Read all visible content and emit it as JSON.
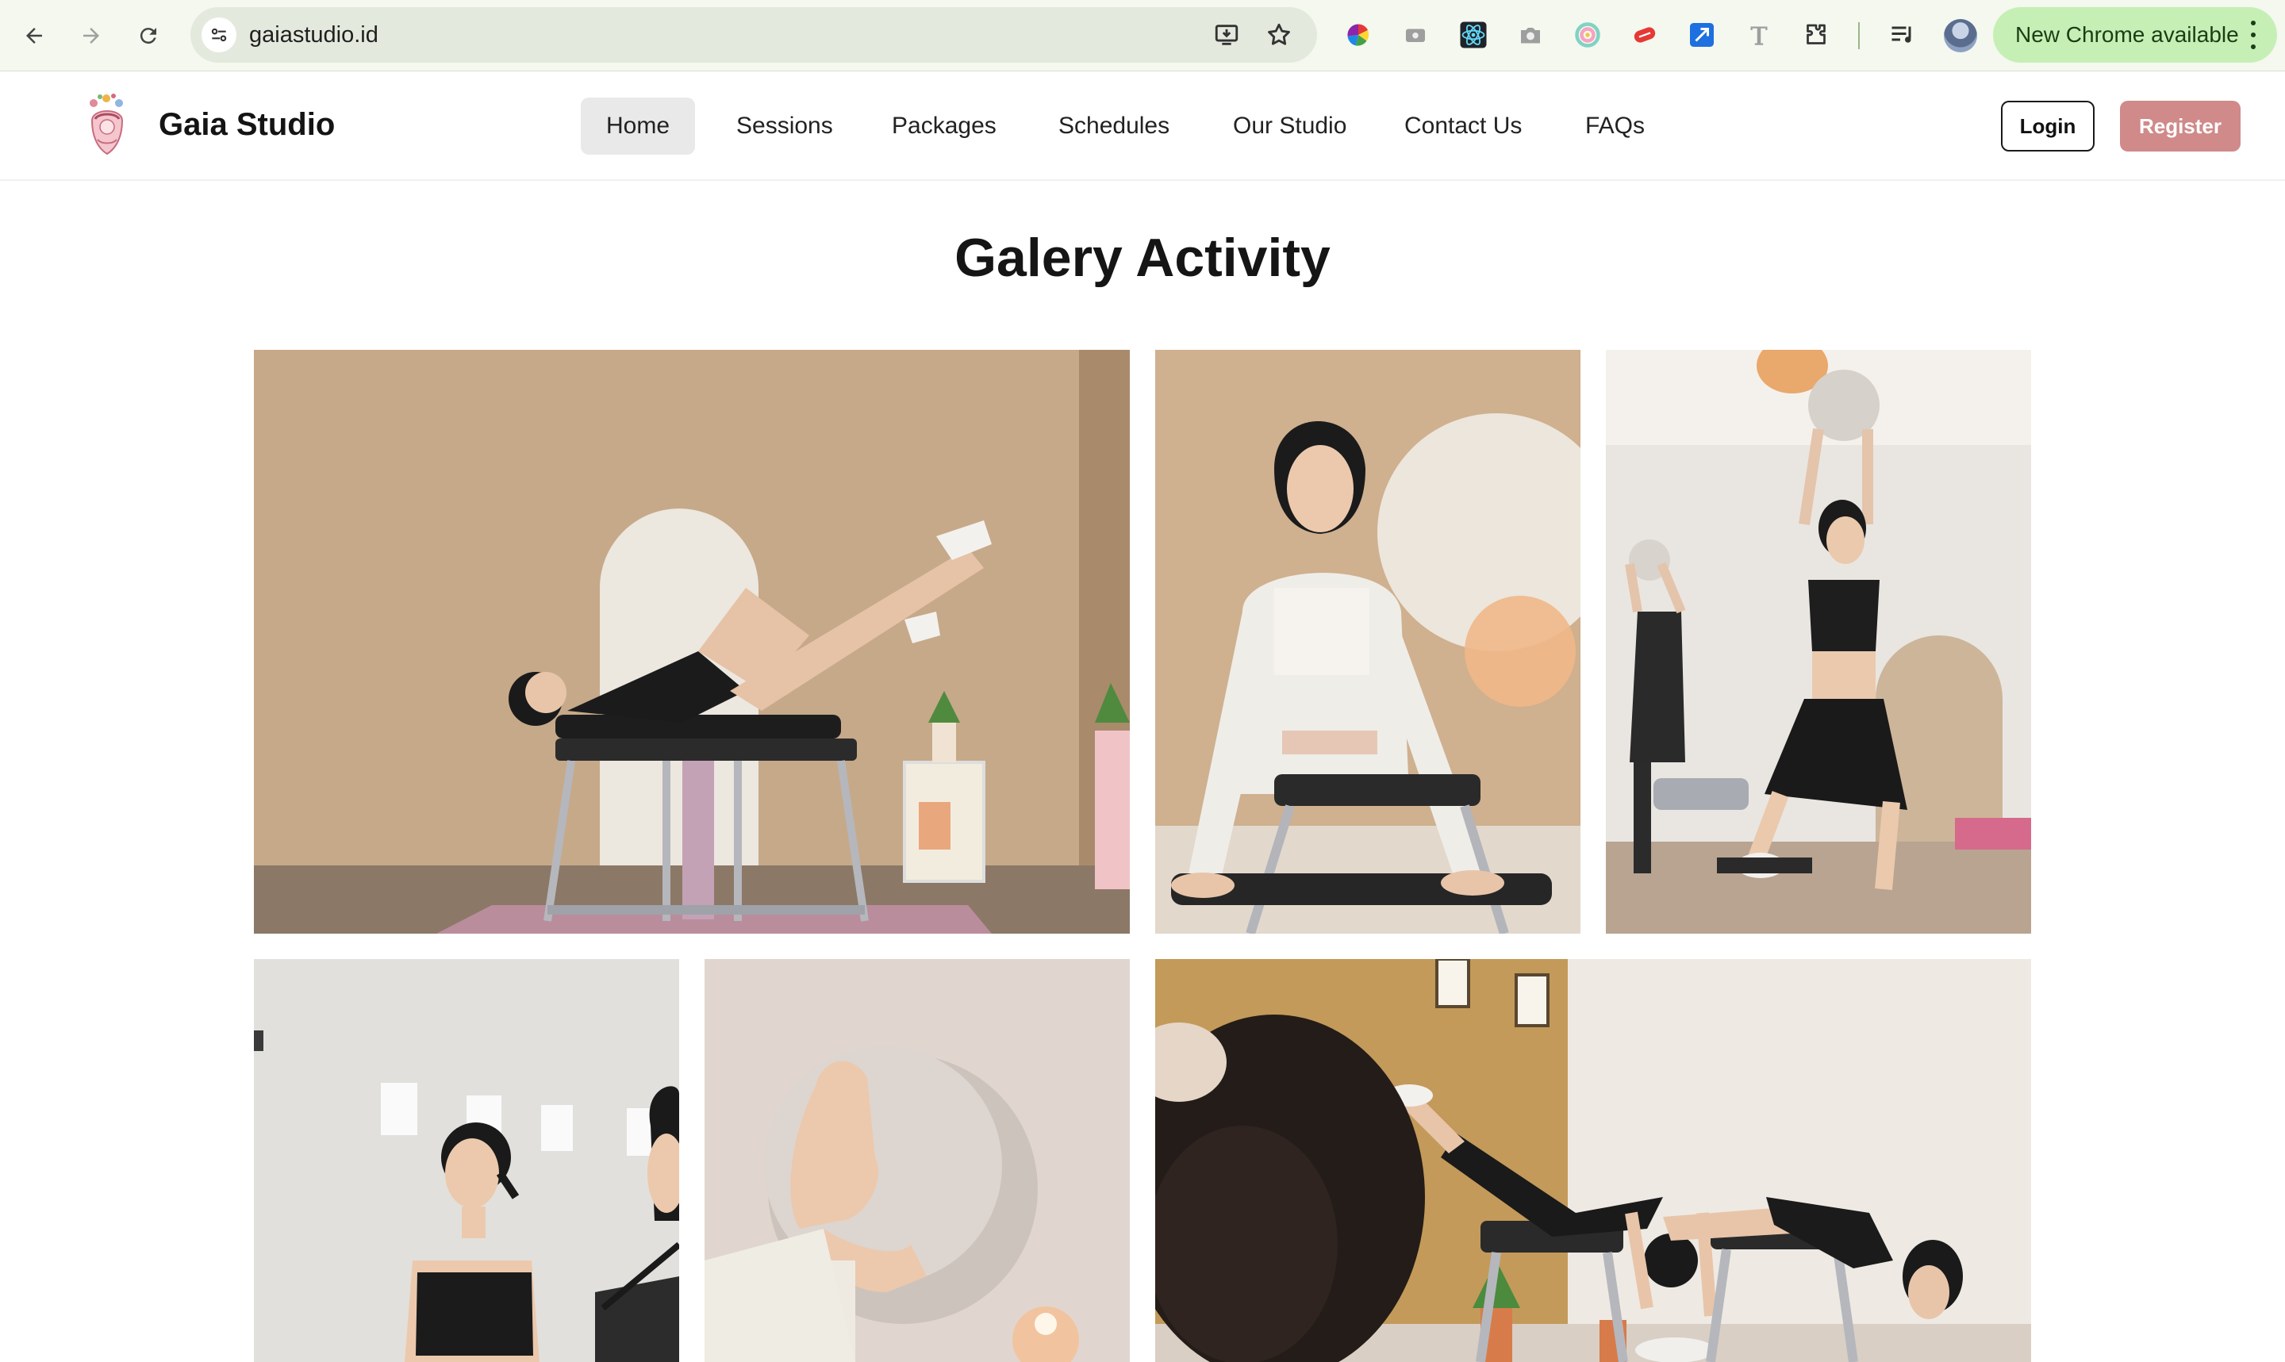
{
  "browser": {
    "url": "gaiastudio.id",
    "update_label": "New Chrome available",
    "icons": [
      "back-icon",
      "forward-icon",
      "reload-icon",
      "site-settings-icon",
      "install-app-icon",
      "bookmark-star-icon",
      "color-picker-extension-icon",
      "screen-recorder-extension-icon",
      "react-devtools-extension-icon",
      "camera-extension-icon",
      "color-wheel-extension-icon",
      "red-pill-extension-icon",
      "image-resize-extension-icon",
      "font-extension-icon",
      "extensions-puzzle-icon",
      "reading-list-icon",
      "profile-avatar",
      "more-vert-icon"
    ]
  },
  "site": {
    "brand_name": "Gaia Studio",
    "nav": [
      {
        "label": "Home",
        "active": true
      },
      {
        "label": "Sessions",
        "active": false
      },
      {
        "label": "Packages",
        "active": false
      },
      {
        "label": "Schedules",
        "active": false
      },
      {
        "label": "Our Studio",
        "active": false
      },
      {
        "label": "Contact Us",
        "active": false
      },
      {
        "label": "FAQs",
        "active": false
      }
    ],
    "login_label": "Login",
    "register_label": "Register",
    "colors": {
      "accent": "#cf8a89",
      "active_nav_bg": "#e9e9e9",
      "chrome_bg": "#f4f8ee",
      "update_pill": "#c6efb6"
    }
  },
  "gallery": {
    "title": "Galery Activity",
    "photos": [
      {
        "id": "photo-reformer-leg-lift"
      },
      {
        "id": "photo-chair-stretch"
      },
      {
        "id": "photo-ball-overhead-lunge"
      },
      {
        "id": "photo-studio-portrait"
      },
      {
        "id": "photo-ball-closeup"
      },
      {
        "id": "photo-chair-pike-group"
      }
    ]
  }
}
